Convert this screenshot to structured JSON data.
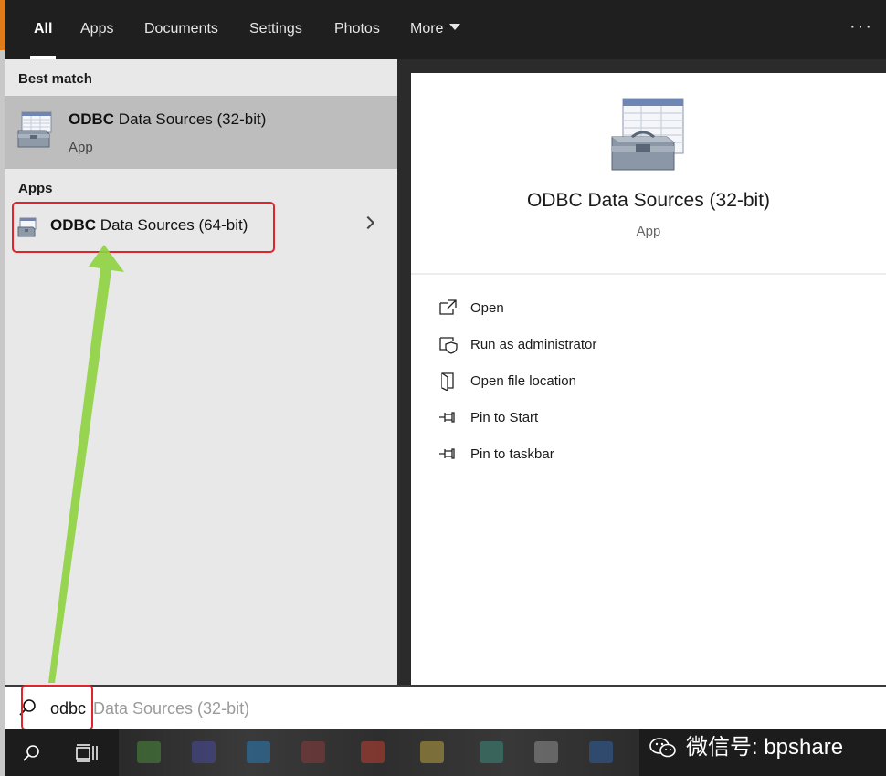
{
  "filter_bar": {
    "tabs": [
      {
        "label": "All",
        "active": true
      },
      {
        "label": "Apps"
      },
      {
        "label": "Documents"
      },
      {
        "label": "Settings"
      },
      {
        "label": "Photos"
      },
      {
        "label": "More"
      }
    ],
    "overflow_icon": "more-dots-icon"
  },
  "results": {
    "best_match_header": "Best match",
    "best_match": {
      "title_bold": "ODBC",
      "title_rest": " Data Sources (32-bit)",
      "subtitle": "App",
      "icon": "odbc-toolbox-icon"
    },
    "apps_header": "Apps",
    "apps": [
      {
        "title_bold": "ODBC",
        "title_rest": " Data Sources (64-bit)",
        "icon": "odbc-toolbox-icon"
      }
    ]
  },
  "preview": {
    "title": "ODBC Data Sources (32-bit)",
    "subtitle": "App",
    "actions": [
      {
        "label": "Open",
        "icon": "open-icon"
      },
      {
        "label": "Run as administrator",
        "icon": "shield-icon"
      },
      {
        "label": "Open file location",
        "icon": "file-location-icon"
      },
      {
        "label": "Pin to Start",
        "icon": "pin-icon"
      },
      {
        "label": "Pin to taskbar",
        "icon": "pin-icon"
      }
    ]
  },
  "search": {
    "typed": "odbc",
    "completion": "Data Sources (32-bit)"
  },
  "taskbar": {
    "watermark": "微信号: bpshare"
  },
  "colors": {
    "highlight_red": "#e0242b",
    "arrow_green": "#8ed13f",
    "selected_row": "#bdbdbd"
  }
}
